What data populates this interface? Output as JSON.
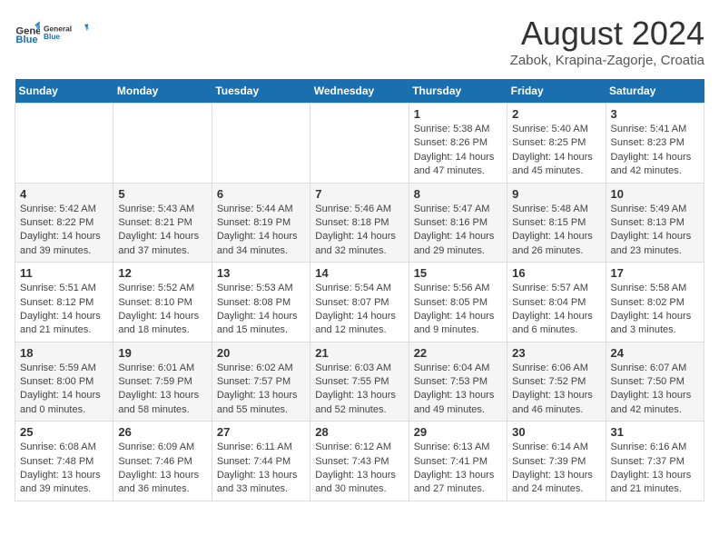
{
  "header": {
    "logo_general": "General",
    "logo_blue": "Blue",
    "title": "August 2024",
    "subtitle": "Zabok, Krapina-Zagorje, Croatia"
  },
  "calendar": {
    "days_of_week": [
      "Sunday",
      "Monday",
      "Tuesday",
      "Wednesday",
      "Thursday",
      "Friday",
      "Saturday"
    ],
    "weeks": [
      [
        {
          "day": "",
          "info": ""
        },
        {
          "day": "",
          "info": ""
        },
        {
          "day": "",
          "info": ""
        },
        {
          "day": "",
          "info": ""
        },
        {
          "day": "1",
          "info": "Sunrise: 5:38 AM\nSunset: 8:26 PM\nDaylight: 14 hours and 47 minutes."
        },
        {
          "day": "2",
          "info": "Sunrise: 5:40 AM\nSunset: 8:25 PM\nDaylight: 14 hours and 45 minutes."
        },
        {
          "day": "3",
          "info": "Sunrise: 5:41 AM\nSunset: 8:23 PM\nDaylight: 14 hours and 42 minutes."
        }
      ],
      [
        {
          "day": "4",
          "info": "Sunrise: 5:42 AM\nSunset: 8:22 PM\nDaylight: 14 hours and 39 minutes."
        },
        {
          "day": "5",
          "info": "Sunrise: 5:43 AM\nSunset: 8:21 PM\nDaylight: 14 hours and 37 minutes."
        },
        {
          "day": "6",
          "info": "Sunrise: 5:44 AM\nSunset: 8:19 PM\nDaylight: 14 hours and 34 minutes."
        },
        {
          "day": "7",
          "info": "Sunrise: 5:46 AM\nSunset: 8:18 PM\nDaylight: 14 hours and 32 minutes."
        },
        {
          "day": "8",
          "info": "Sunrise: 5:47 AM\nSunset: 8:16 PM\nDaylight: 14 hours and 29 minutes."
        },
        {
          "day": "9",
          "info": "Sunrise: 5:48 AM\nSunset: 8:15 PM\nDaylight: 14 hours and 26 minutes."
        },
        {
          "day": "10",
          "info": "Sunrise: 5:49 AM\nSunset: 8:13 PM\nDaylight: 14 hours and 23 minutes."
        }
      ],
      [
        {
          "day": "11",
          "info": "Sunrise: 5:51 AM\nSunset: 8:12 PM\nDaylight: 14 hours and 21 minutes."
        },
        {
          "day": "12",
          "info": "Sunrise: 5:52 AM\nSunset: 8:10 PM\nDaylight: 14 hours and 18 minutes."
        },
        {
          "day": "13",
          "info": "Sunrise: 5:53 AM\nSunset: 8:08 PM\nDaylight: 14 hours and 15 minutes."
        },
        {
          "day": "14",
          "info": "Sunrise: 5:54 AM\nSunset: 8:07 PM\nDaylight: 14 hours and 12 minutes."
        },
        {
          "day": "15",
          "info": "Sunrise: 5:56 AM\nSunset: 8:05 PM\nDaylight: 14 hours and 9 minutes."
        },
        {
          "day": "16",
          "info": "Sunrise: 5:57 AM\nSunset: 8:04 PM\nDaylight: 14 hours and 6 minutes."
        },
        {
          "day": "17",
          "info": "Sunrise: 5:58 AM\nSunset: 8:02 PM\nDaylight: 14 hours and 3 minutes."
        }
      ],
      [
        {
          "day": "18",
          "info": "Sunrise: 5:59 AM\nSunset: 8:00 PM\nDaylight: 14 hours and 0 minutes."
        },
        {
          "day": "19",
          "info": "Sunrise: 6:01 AM\nSunset: 7:59 PM\nDaylight: 13 hours and 58 minutes."
        },
        {
          "day": "20",
          "info": "Sunrise: 6:02 AM\nSunset: 7:57 PM\nDaylight: 13 hours and 55 minutes."
        },
        {
          "day": "21",
          "info": "Sunrise: 6:03 AM\nSunset: 7:55 PM\nDaylight: 13 hours and 52 minutes."
        },
        {
          "day": "22",
          "info": "Sunrise: 6:04 AM\nSunset: 7:53 PM\nDaylight: 13 hours and 49 minutes."
        },
        {
          "day": "23",
          "info": "Sunrise: 6:06 AM\nSunset: 7:52 PM\nDaylight: 13 hours and 46 minutes."
        },
        {
          "day": "24",
          "info": "Sunrise: 6:07 AM\nSunset: 7:50 PM\nDaylight: 13 hours and 42 minutes."
        }
      ],
      [
        {
          "day": "25",
          "info": "Sunrise: 6:08 AM\nSunset: 7:48 PM\nDaylight: 13 hours and 39 minutes."
        },
        {
          "day": "26",
          "info": "Sunrise: 6:09 AM\nSunset: 7:46 PM\nDaylight: 13 hours and 36 minutes."
        },
        {
          "day": "27",
          "info": "Sunrise: 6:11 AM\nSunset: 7:44 PM\nDaylight: 13 hours and 33 minutes."
        },
        {
          "day": "28",
          "info": "Sunrise: 6:12 AM\nSunset: 7:43 PM\nDaylight: 13 hours and 30 minutes."
        },
        {
          "day": "29",
          "info": "Sunrise: 6:13 AM\nSunset: 7:41 PM\nDaylight: 13 hours and 27 minutes."
        },
        {
          "day": "30",
          "info": "Sunrise: 6:14 AM\nSunset: 7:39 PM\nDaylight: 13 hours and 24 minutes."
        },
        {
          "day": "31",
          "info": "Sunrise: 6:16 AM\nSunset: 7:37 PM\nDaylight: 13 hours and 21 minutes."
        }
      ]
    ]
  }
}
